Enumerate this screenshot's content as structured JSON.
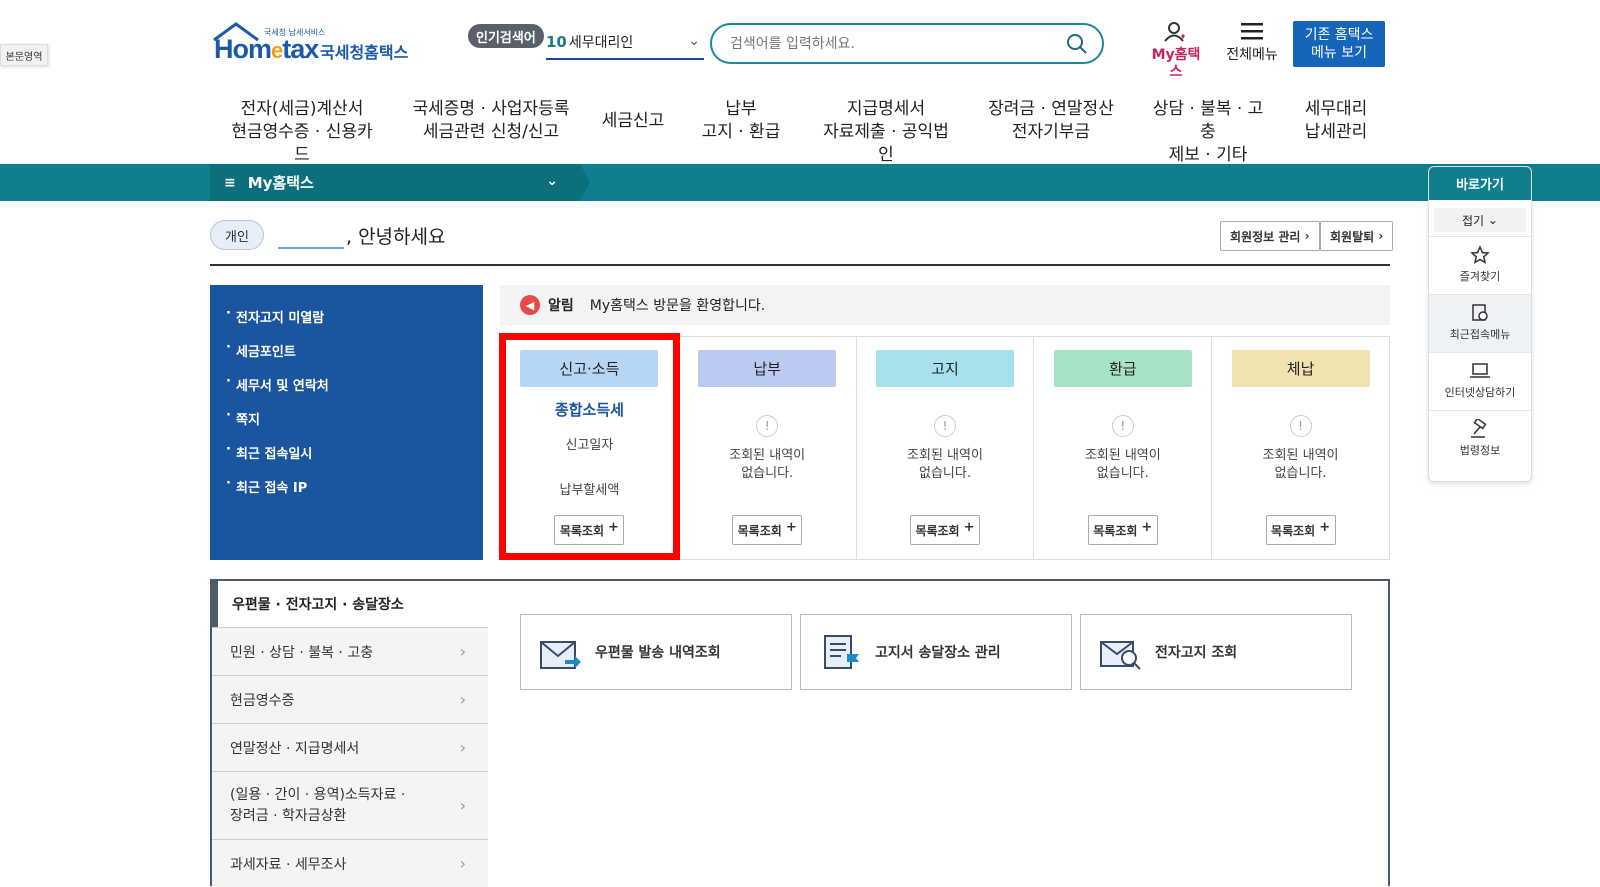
{
  "skip_link": "본문영역",
  "logo": {
    "brand_left": "Hom",
    "brand_mid": "e",
    "brand_right": "tax",
    "small": "국세청 납세서비스",
    "name": "국세청홈택스"
  },
  "popular": {
    "tag": "인기검색어",
    "rank": "10",
    "term": "세무대리인"
  },
  "search": {
    "placeholder": "검색어를 입력하세요."
  },
  "header": {
    "myhometax": "My홈택스",
    "allmenu": "전체메뉴",
    "oldmenu_line1": "기존 홈택스",
    "oldmenu_line2": "메뉴 보기"
  },
  "gnb": [
    {
      "l1": "전자(세금)계산서",
      "l2": "현금영수증 · 신용카드"
    },
    {
      "l1": "국세증명 · 사업자등록",
      "l2": "세금관련 신청/신고"
    },
    {
      "l1": "세금신고",
      "l2": ""
    },
    {
      "l1": "납부",
      "l2": "고지 · 환급"
    },
    {
      "l1": "지급명세서",
      "l2": "자료제출 · 공익법인"
    },
    {
      "l1": "장려금 · 연말정산",
      "l2": "전자기부금"
    },
    {
      "l1": "상담 · 불복 · 고충",
      "l2": "제보 · 기타"
    },
    {
      "l1": "세무대리",
      "l2": "납세관리"
    }
  ],
  "subbar": {
    "title": "My홈택스"
  },
  "greeting": {
    "badge": "개인",
    "hello": ", 안녕하세요"
  },
  "member_buttons": {
    "info": "회원정보 관리",
    "withdraw": "회원탈퇴"
  },
  "left_menu": [
    "전자고지 미열람",
    "세금포인트",
    "세무서 및 연락처",
    "쪽지",
    "최근 접속일시",
    "최근 접속 IP"
  ],
  "notice": {
    "label": "알림",
    "text": "My홈택스 방문을 환영합니다."
  },
  "cards": [
    {
      "head": "신고·소득",
      "color": "#b5d6f4",
      "tax": "종합소득세",
      "sub1": "신고일자",
      "sub2": "납부할세액",
      "btn": "목록조회"
    },
    {
      "head": "납부",
      "color": "#bcc9f3",
      "none1": "조회된 내역이",
      "none2": "없습니다.",
      "btn": "목록조회"
    },
    {
      "head": "고지",
      "color": "#a7e1eb",
      "none1": "조회된 내역이",
      "none2": "없습니다.",
      "btn": "목록조회"
    },
    {
      "head": "환급",
      "color": "#a8e2c4",
      "none1": "조회된 내역이",
      "none2": "없습니다.",
      "btn": "목록조회"
    },
    {
      "head": "체납",
      "color": "#f1e2b1",
      "none1": "조회된 내역이",
      "none2": "없습니다.",
      "btn": "목록조회"
    }
  ],
  "section2": {
    "title": "우편물 · 전자고지 · 송달장소",
    "menu": [
      "민원 · 상담 · 불복 · 고충",
      "현금영수증",
      "연말정산 · 지급명세서",
      "(일용 · 간이 · 용역)소득자료 ·",
      "장려금 · 학자금상환",
      "과세자료 · 세무조사"
    ],
    "tiles": [
      "우편물 발송 내역조회",
      "고지서 송달장소 관리",
      "전자고지 조회"
    ]
  },
  "quick": {
    "title": "바로가기",
    "fold": "접기",
    "items": [
      "즐겨찾기",
      "최근접속메뉴",
      "인터넷상담하기",
      "법령정보"
    ]
  }
}
